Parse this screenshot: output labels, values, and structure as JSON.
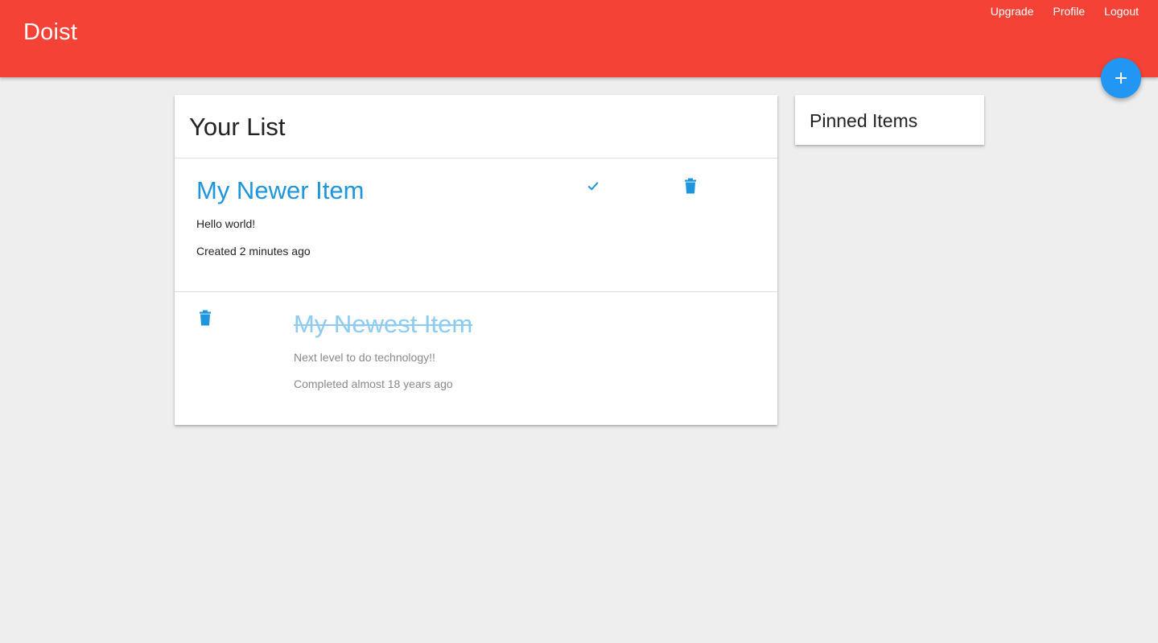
{
  "app": {
    "brand": "Doist"
  },
  "nav": {
    "upgrade": "Upgrade",
    "profile": "Profile",
    "logout": "Logout"
  },
  "fab": {
    "icon": "plus-icon"
  },
  "list": {
    "title": "Your List",
    "items": [
      {
        "title": "My Newer Item",
        "description": "Hello world!",
        "timestamp": "Created 2 minutes ago",
        "completed": false
      },
      {
        "title": "My Newest Item",
        "description": "Next level to do technology!!",
        "timestamp": "Completed almost 18 years ago",
        "completed": true
      }
    ]
  },
  "pinned": {
    "title": "Pinned Items"
  },
  "colors": {
    "appbar": "#f44336",
    "accent": "#2196f3",
    "link": "#1e95dc",
    "background": "#eeeeee"
  }
}
